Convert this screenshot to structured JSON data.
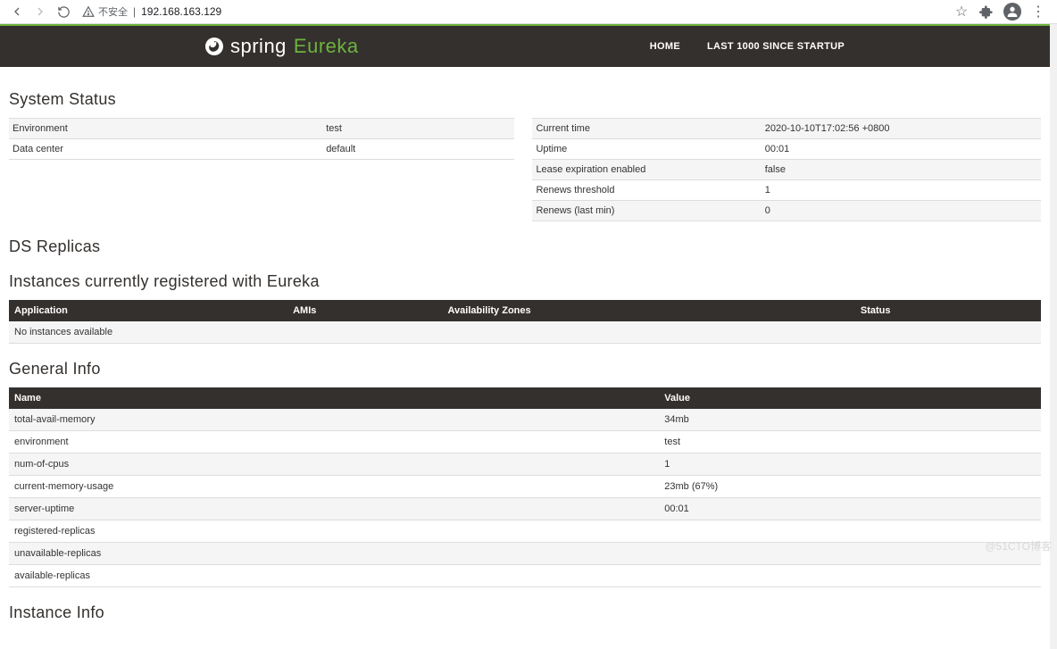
{
  "browser": {
    "url": "192.168.163.129",
    "insecure_label": "不安全",
    "separator": "|"
  },
  "nav": {
    "brand_spring": "spring",
    "brand_eureka": "Eureka",
    "links": {
      "home": "HOME",
      "startup": "LAST 1000 SINCE STARTUP"
    }
  },
  "sections": {
    "system_status": "System Status",
    "ds_replicas": "DS Replicas",
    "instances": "Instances currently registered with Eureka",
    "general_info": "General Info",
    "instance_info": "Instance Info"
  },
  "system_status_left": [
    {
      "k": "Environment",
      "v": "test"
    },
    {
      "k": "Data center",
      "v": "default"
    }
  ],
  "system_status_right": [
    {
      "k": "Current time",
      "v": "2020-10-10T17:02:56 +0800"
    },
    {
      "k": "Uptime",
      "v": "00:01"
    },
    {
      "k": "Lease expiration enabled",
      "v": "false"
    },
    {
      "k": "Renews threshold",
      "v": "1"
    },
    {
      "k": "Renews (last min)",
      "v": "0"
    }
  ],
  "instances_table": {
    "headers": {
      "application": "Application",
      "amis": "AMIs",
      "az": "Availability Zones",
      "status": "Status"
    },
    "empty_message": "No instances available"
  },
  "general_info": {
    "headers": {
      "name": "Name",
      "value": "Value"
    },
    "rows": [
      {
        "name": "total-avail-memory",
        "value": "34mb"
      },
      {
        "name": "environment",
        "value": "test"
      },
      {
        "name": "num-of-cpus",
        "value": "1"
      },
      {
        "name": "current-memory-usage",
        "value": "23mb (67%)"
      },
      {
        "name": "server-uptime",
        "value": "00:01"
      },
      {
        "name": "registered-replicas",
        "value": ""
      },
      {
        "name": "unavailable-replicas",
        "value": ""
      },
      {
        "name": "available-replicas",
        "value": ""
      }
    ]
  },
  "watermark": "@51CTO博客"
}
